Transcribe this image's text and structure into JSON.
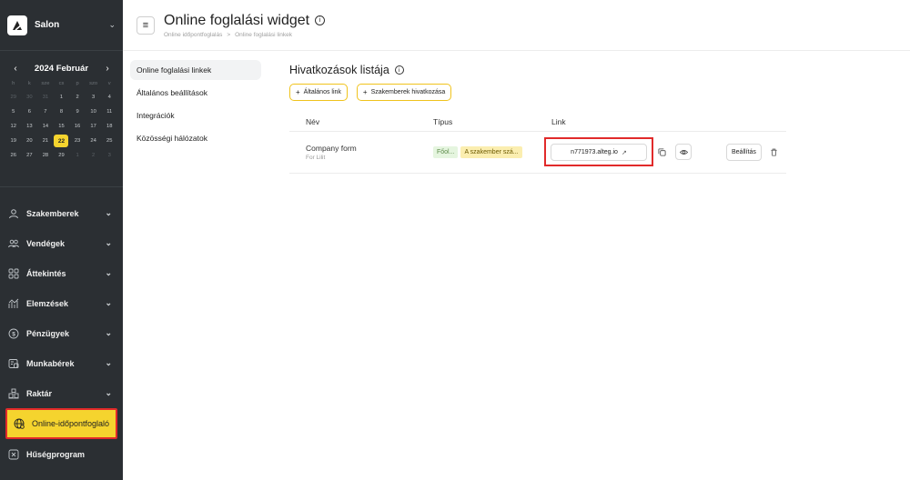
{
  "sidebar": {
    "brand": "Salon",
    "calendar": {
      "title": "2024 Február",
      "weekdays": [
        "h",
        "k",
        "sze",
        "cs",
        "p",
        "szo",
        "v"
      ],
      "weeks": [
        [
          "29",
          "30",
          "31",
          "1",
          "2",
          "3",
          "4"
        ],
        [
          "5",
          "6",
          "7",
          "8",
          "9",
          "10",
          "11"
        ],
        [
          "12",
          "13",
          "14",
          "15",
          "16",
          "17",
          "18"
        ],
        [
          "19",
          "20",
          "21",
          "22",
          "23",
          "24",
          "25"
        ],
        [
          "26",
          "27",
          "28",
          "29",
          "1",
          "2",
          "3"
        ]
      ],
      "today": "22"
    },
    "items": [
      {
        "label": "Szakemberek",
        "icon": "person-icon"
      },
      {
        "label": "Vendégek",
        "icon": "users-icon"
      },
      {
        "label": "Áttekintés",
        "icon": "grid-icon"
      },
      {
        "label": "Elemzések",
        "icon": "analytics-icon"
      },
      {
        "label": "Pénzügyek",
        "icon": "dollar-icon"
      },
      {
        "label": "Munkabérek",
        "icon": "payroll-icon"
      },
      {
        "label": "Raktár",
        "icon": "warehouse-icon"
      },
      {
        "label": "Online-időpontfoglaló",
        "icon": "globe-icon"
      },
      {
        "label": "Hűségprogram",
        "icon": "loyalty-icon"
      }
    ]
  },
  "header": {
    "title": "Online foglalási widget",
    "breadcrumb": [
      "Online időpontfoglalás",
      ">",
      "Online foglalási linkek"
    ]
  },
  "subnav": {
    "items": [
      "Online foglalási linkek",
      "Általános beállítások",
      "Integrációk",
      "Közösségi hálózatok"
    ]
  },
  "panel": {
    "title": "Hivatkozások listája",
    "general_link_btn": "Általános link",
    "specialists_link_btn": "Szakemberek hivatkozása",
    "columns": {
      "name": "Név",
      "type": "Típus",
      "link": "Link"
    },
    "rows": [
      {
        "name": "Company form",
        "sub": "For Lilit",
        "tag1": "Főol...",
        "tag2": "A szakember szá...",
        "link": "n771973.alteg.io",
        "settings": "Beállítás"
      }
    ]
  },
  "colors": {
    "sidebar_bg": "#2b2f33",
    "accent_yellow": "#f5d42e",
    "highlight_red": "#e12a2a"
  }
}
